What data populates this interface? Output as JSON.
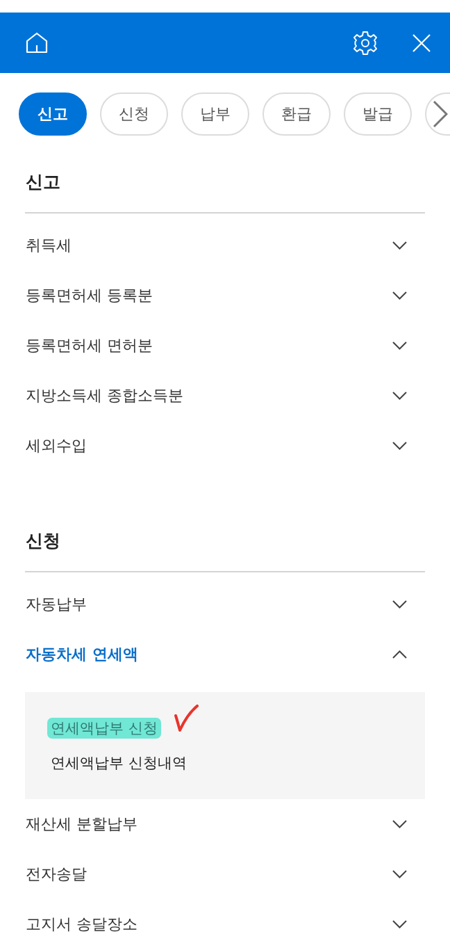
{
  "category_tabs": [
    {
      "label": "신고",
      "selected": true
    },
    {
      "label": "신청",
      "selected": false
    },
    {
      "label": "납부",
      "selected": false
    },
    {
      "label": "환급",
      "selected": false
    },
    {
      "label": "발급",
      "selected": false
    }
  ],
  "sections": [
    {
      "title": "신고",
      "items": [
        {
          "label": "취득세",
          "expanded": false
        },
        {
          "label": "등록면허세 등록분",
          "expanded": false
        },
        {
          "label": "등록면허세 면허분",
          "expanded": false
        },
        {
          "label": "지방소득세 종합소득분",
          "expanded": false
        },
        {
          "label": "세외수입",
          "expanded": false
        }
      ]
    },
    {
      "title": "신청",
      "items": [
        {
          "label": "자동납부",
          "expanded": false
        },
        {
          "label": "자동차세 연세액",
          "expanded": true,
          "sub_items": [
            {
              "label": "연세액납부 신청",
              "highlighted": true,
              "check_mark": true
            },
            {
              "label": "연세액납부 신청내역",
              "highlighted": false,
              "check_mark": false
            }
          ]
        },
        {
          "label": "재산세 분할납부",
          "expanded": false
        },
        {
          "label": "전자송달",
          "expanded": false
        },
        {
          "label": "고지서 송달장소",
          "expanded": false
        }
      ]
    }
  ]
}
